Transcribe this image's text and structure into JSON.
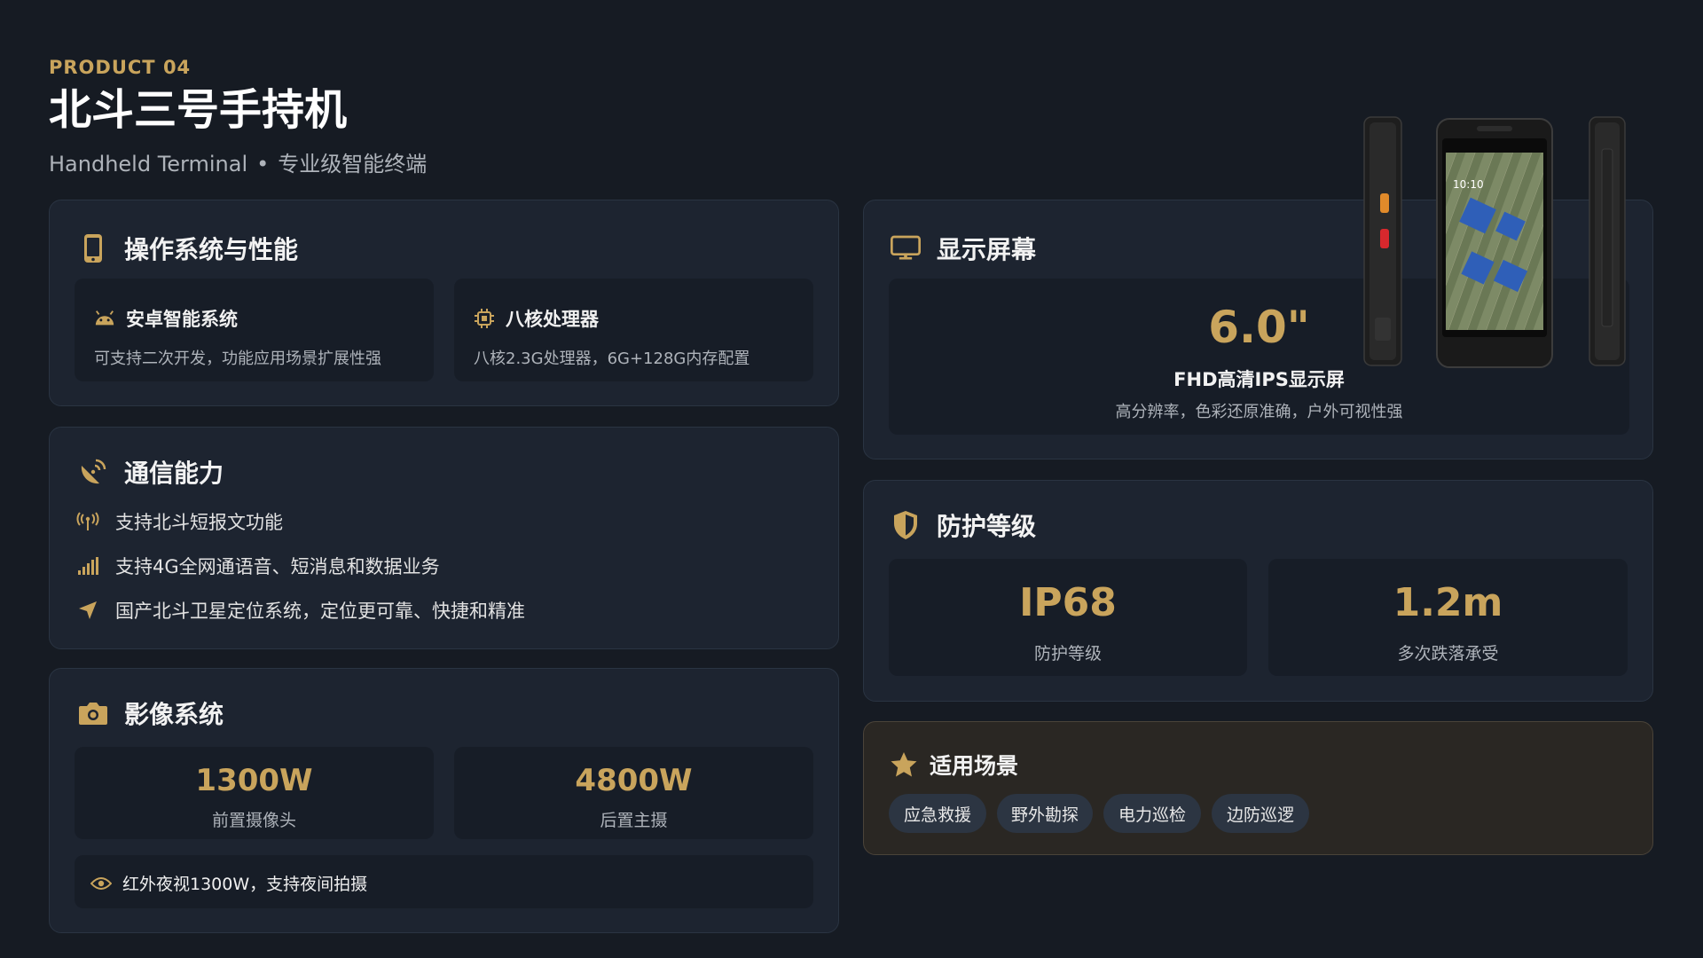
{
  "header": {
    "kicker": "PRODUCT 04",
    "title": "北斗三号手持机",
    "subtitle_en": "Handheld Terminal",
    "subtitle_sep": "•",
    "subtitle_cn": "专业级智能终端"
  },
  "os_card": {
    "title": "操作系统与性能",
    "items": [
      {
        "title": "安卓智能系统",
        "desc": "可支持二次开发，功能应用场景扩展性强",
        "icon": "android-icon"
      },
      {
        "title": "八核处理器",
        "desc": "八核2.3G处理器，6G+128G内存配置",
        "icon": "cpu-icon"
      }
    ]
  },
  "comm_card": {
    "title": "通信能力",
    "features": [
      {
        "text": "支持北斗短报文功能",
        "icon": "antenna-icon"
      },
      {
        "text": "支持4G全网通语音、短消息和数据业务",
        "icon": "signal-icon"
      },
      {
        "text": "国产北斗卫星定位系统，定位更可靠、快捷和精准",
        "icon": "location-arrow-icon"
      }
    ]
  },
  "camera_card": {
    "title": "影像系统",
    "stats": [
      {
        "value": "1300W",
        "label": "前置摄像头"
      },
      {
        "value": "4800W",
        "label": "后置主摄"
      }
    ],
    "night_vision": "红外夜视1300W，支持夜间拍摄"
  },
  "screen_card": {
    "title": "显示屏幕",
    "size": "6.0\"",
    "type": "FHD高清IPS显示屏",
    "desc": "高分辨率，色彩还原准确，户外可视性强"
  },
  "protection_card": {
    "title": "防护等级",
    "stats": [
      {
        "value": "IP68",
        "label": "防护等级"
      },
      {
        "value": "1.2m",
        "label": "多次跌落承受"
      }
    ]
  },
  "scenario_card": {
    "title": "适用场景",
    "tags": [
      "应急救援",
      "野外勘探",
      "电力巡检",
      "边防巡逻"
    ]
  },
  "phone_screen": {
    "time": "10:10"
  },
  "colors": {
    "accent": "#c9a45c",
    "background": "#161b23",
    "card": "#1d2430"
  }
}
